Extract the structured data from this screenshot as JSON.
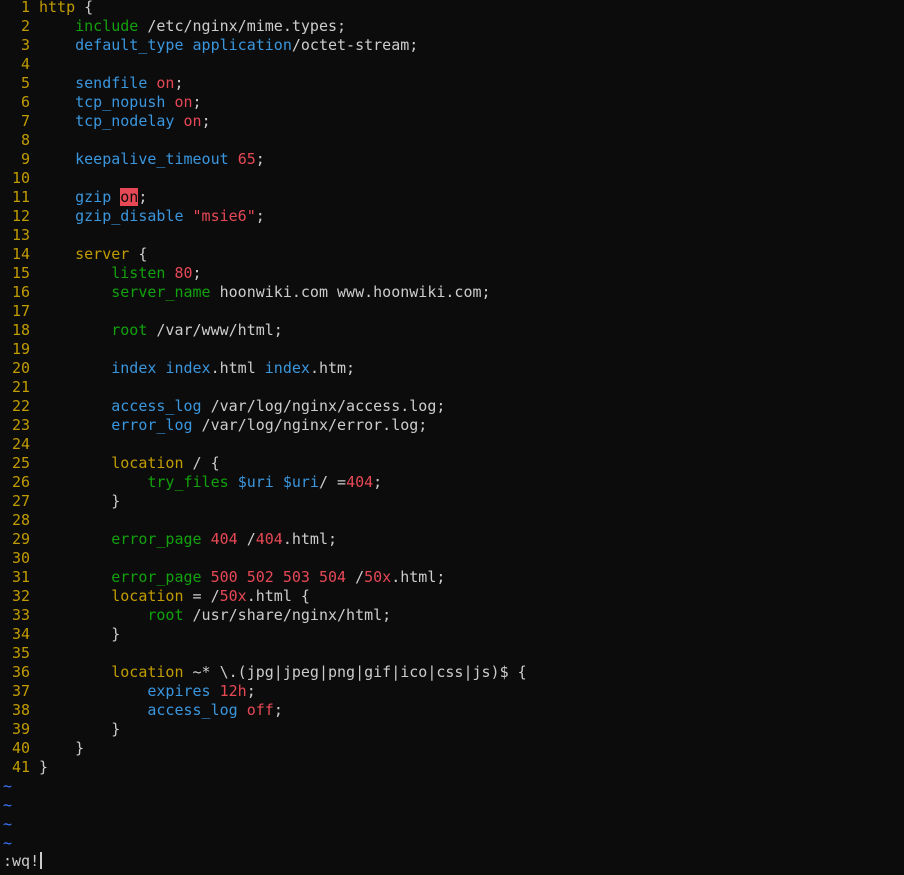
{
  "lines": [
    [
      {
        "t": "http",
        "c": "type"
      },
      {
        "t": " {",
        "c": "plain"
      }
    ],
    [
      {
        "t": "    ",
        "c": "plain"
      },
      {
        "t": "include",
        "c": "ident"
      },
      {
        "t": " /etc/nginx/mime.types;",
        "c": "plain"
      }
    ],
    [
      {
        "t": "    ",
        "c": "plain"
      },
      {
        "t": "default_type",
        "c": "stmt"
      },
      {
        "t": " ",
        "c": "plain"
      },
      {
        "t": "application",
        "c": "stmt"
      },
      {
        "t": "/octet-stream;",
        "c": "plain"
      }
    ],
    [],
    [
      {
        "t": "    ",
        "c": "plain"
      },
      {
        "t": "sendfile",
        "c": "stmt"
      },
      {
        "t": " ",
        "c": "plain"
      },
      {
        "t": "on",
        "c": "const"
      },
      {
        "t": ";",
        "c": "plain"
      }
    ],
    [
      {
        "t": "    ",
        "c": "plain"
      },
      {
        "t": "tcp_nopush",
        "c": "stmt"
      },
      {
        "t": " ",
        "c": "plain"
      },
      {
        "t": "on",
        "c": "const"
      },
      {
        "t": ";",
        "c": "plain"
      }
    ],
    [
      {
        "t": "    ",
        "c": "plain"
      },
      {
        "t": "tcp_nodelay",
        "c": "stmt"
      },
      {
        "t": " ",
        "c": "plain"
      },
      {
        "t": "on",
        "c": "const"
      },
      {
        "t": ";",
        "c": "plain"
      }
    ],
    [],
    [
      {
        "t": "    ",
        "c": "plain"
      },
      {
        "t": "keepalive_timeout",
        "c": "stmt"
      },
      {
        "t": " ",
        "c": "plain"
      },
      {
        "t": "65",
        "c": "const"
      },
      {
        "t": ";",
        "c": "plain"
      }
    ],
    [],
    [
      {
        "t": "    ",
        "c": "plain"
      },
      {
        "t": "gzip",
        "c": "stmt"
      },
      {
        "t": " ",
        "c": "plain"
      },
      {
        "t": "on",
        "c": "search"
      },
      {
        "t": ";",
        "c": "plain"
      }
    ],
    [
      {
        "t": "    ",
        "c": "plain"
      },
      {
        "t": "gzip_disable",
        "c": "stmt"
      },
      {
        "t": " ",
        "c": "plain"
      },
      {
        "t": "\"msie6\"",
        "c": "const"
      },
      {
        "t": ";",
        "c": "plain"
      }
    ],
    [],
    [
      {
        "t": "    ",
        "c": "plain"
      },
      {
        "t": "server",
        "c": "type"
      },
      {
        "t": " {",
        "c": "plain"
      }
    ],
    [
      {
        "t": "        ",
        "c": "plain"
      },
      {
        "t": "listen",
        "c": "ident"
      },
      {
        "t": " ",
        "c": "plain"
      },
      {
        "t": "80",
        "c": "const"
      },
      {
        "t": ";",
        "c": "plain"
      }
    ],
    [
      {
        "t": "        ",
        "c": "plain"
      },
      {
        "t": "server_name",
        "c": "ident"
      },
      {
        "t": " hoonwiki.com www.hoonwiki.com;",
        "c": "plain"
      }
    ],
    [],
    [
      {
        "t": "        ",
        "c": "plain"
      },
      {
        "t": "root",
        "c": "ident"
      },
      {
        "t": " /var/www/html;",
        "c": "plain"
      }
    ],
    [],
    [
      {
        "t": "        ",
        "c": "plain"
      },
      {
        "t": "index",
        "c": "stmt"
      },
      {
        "t": " ",
        "c": "plain"
      },
      {
        "t": "index",
        "c": "stmt"
      },
      {
        "t": ".html ",
        "c": "plain"
      },
      {
        "t": "index",
        "c": "stmt"
      },
      {
        "t": ".htm;",
        "c": "plain"
      }
    ],
    [],
    [
      {
        "t": "        ",
        "c": "plain"
      },
      {
        "t": "access_log",
        "c": "stmt"
      },
      {
        "t": " /var/log/nginx/access.log;",
        "c": "plain"
      }
    ],
    [
      {
        "t": "        ",
        "c": "plain"
      },
      {
        "t": "error_log",
        "c": "stmt"
      },
      {
        "t": " /var/log/nginx/error.log;",
        "c": "plain"
      }
    ],
    [],
    [
      {
        "t": "        ",
        "c": "plain"
      },
      {
        "t": "location",
        "c": "type"
      },
      {
        "t": " / {",
        "c": "plain"
      }
    ],
    [
      {
        "t": "            ",
        "c": "plain"
      },
      {
        "t": "try_files",
        "c": "ident"
      },
      {
        "t": " ",
        "c": "plain"
      },
      {
        "t": "$uri",
        "c": "stmt"
      },
      {
        "t": " ",
        "c": "plain"
      },
      {
        "t": "$uri",
        "c": "stmt"
      },
      {
        "t": "/ =",
        "c": "plain"
      },
      {
        "t": "404",
        "c": "const"
      },
      {
        "t": ";",
        "c": "plain"
      }
    ],
    [
      {
        "t": "        }",
        "c": "plain"
      }
    ],
    [],
    [
      {
        "t": "        ",
        "c": "plain"
      },
      {
        "t": "error_page",
        "c": "ident"
      },
      {
        "t": " ",
        "c": "plain"
      },
      {
        "t": "404",
        "c": "const"
      },
      {
        "t": " /",
        "c": "plain"
      },
      {
        "t": "404",
        "c": "const"
      },
      {
        "t": ".html;",
        "c": "plain"
      }
    ],
    [],
    [
      {
        "t": "        ",
        "c": "plain"
      },
      {
        "t": "error_page",
        "c": "ident"
      },
      {
        "t": " ",
        "c": "plain"
      },
      {
        "t": "500 502 503 504",
        "c": "const"
      },
      {
        "t": " /",
        "c": "plain"
      },
      {
        "t": "50x",
        "c": "const"
      },
      {
        "t": ".html;",
        "c": "plain"
      }
    ],
    [
      {
        "t": "        ",
        "c": "plain"
      },
      {
        "t": "location",
        "c": "type"
      },
      {
        "t": " = /",
        "c": "plain"
      },
      {
        "t": "50x",
        "c": "const"
      },
      {
        "t": ".html {",
        "c": "plain"
      }
    ],
    [
      {
        "t": "            ",
        "c": "plain"
      },
      {
        "t": "root",
        "c": "ident"
      },
      {
        "t": " /usr/share/nginx/html;",
        "c": "plain"
      }
    ],
    [
      {
        "t": "        }",
        "c": "plain"
      }
    ],
    [],
    [
      {
        "t": "        ",
        "c": "plain"
      },
      {
        "t": "location",
        "c": "type"
      },
      {
        "t": " ~* \\.(jpg|jpeg|png|gif|ico|css|js)$ {",
        "c": "plain"
      }
    ],
    [
      {
        "t": "            ",
        "c": "plain"
      },
      {
        "t": "expires",
        "c": "stmt"
      },
      {
        "t": " ",
        "c": "plain"
      },
      {
        "t": "12h",
        "c": "const"
      },
      {
        "t": ";",
        "c": "plain"
      }
    ],
    [
      {
        "t": "            ",
        "c": "plain"
      },
      {
        "t": "access_log",
        "c": "stmt"
      },
      {
        "t": " ",
        "c": "plain"
      },
      {
        "t": "off",
        "c": "const"
      },
      {
        "t": ";",
        "c": "plain"
      }
    ],
    [
      {
        "t": "        }",
        "c": "plain"
      }
    ],
    [
      {
        "t": "    }",
        "c": "plain"
      }
    ],
    [
      {
        "t": "}",
        "c": "plain"
      }
    ]
  ],
  "empty_line_markers": [
    "~",
    "~",
    "~",
    "~"
  ],
  "command_line": ":wq!",
  "colors": {
    "background": "#0c0c0c",
    "line_number": "#c19c00",
    "block_keyword": "#c19c00",
    "directive": "#3a96dd",
    "directive_alt": "#13a10e",
    "constant": "#e74856",
    "search_highlight_bg": "#e74856",
    "tilde": "#3b78ff",
    "text": "#cccccc"
  }
}
